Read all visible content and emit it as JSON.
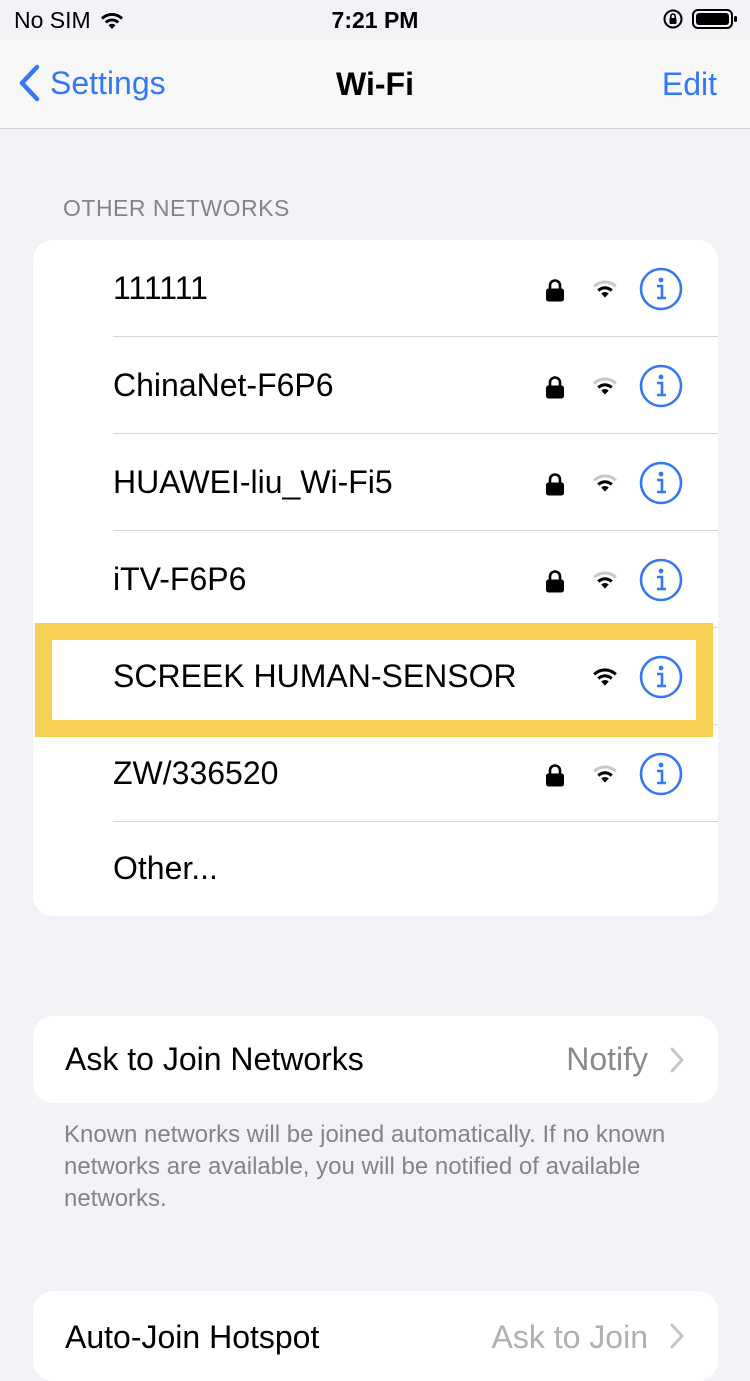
{
  "status_bar": {
    "carrier": "No SIM",
    "time": "7:21 PM"
  },
  "nav": {
    "back_label": "Settings",
    "title": "Wi-Fi",
    "edit_label": "Edit"
  },
  "other_networks": {
    "header": "OTHER NETWORKS",
    "items": [
      {
        "name": "111111",
        "locked": true
      },
      {
        "name": "ChinaNet-F6P6",
        "locked": true
      },
      {
        "name": "HUAWEI-liu_Wi-Fi5",
        "locked": true
      },
      {
        "name": "iTV-F6P6",
        "locked": true
      },
      {
        "name": "SCREEK HUMAN-SENSOR",
        "locked": false
      },
      {
        "name": "ZW/336520",
        "locked": true
      }
    ],
    "other_label": "Other..."
  },
  "ask_to_join": {
    "label": "Ask to Join Networks",
    "value": "Notify"
  },
  "ask_footnote": "Known networks will be joined automatically. If no known networks are available, you will be notified of available networks.",
  "auto_join": {
    "label": "Auto-Join Hotspot",
    "value": "Ask to Join"
  },
  "colors": {
    "accent": "#3478f6",
    "highlight": "#f5d055",
    "background": "#f2f2f7"
  },
  "icons": [
    "wifi-icon",
    "lock-icon",
    "info-icon",
    "chevron-left-icon",
    "chevron-right-icon",
    "battery-icon",
    "orientation-lock-icon"
  ]
}
